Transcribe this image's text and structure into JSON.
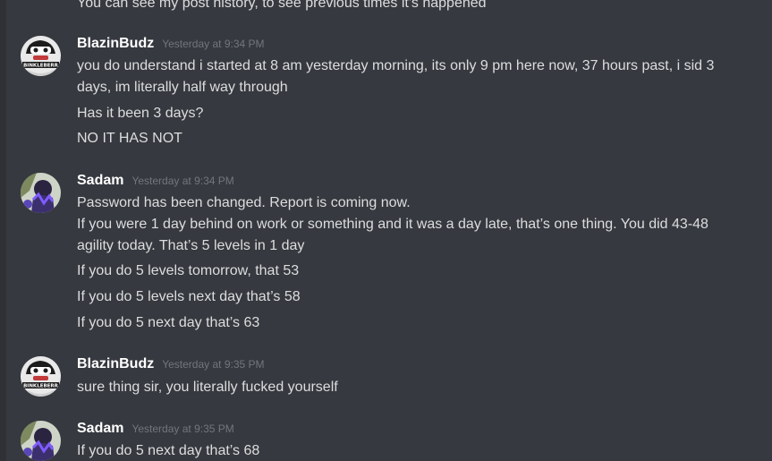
{
  "messages": {
    "top_cut": "You can see my post history, to see previous times it's happened",
    "m1": {
      "username": "BlazinBudz",
      "timestamp": "Yesterday at 9:34 PM",
      "lines": [
        "you do understand i started at 8 am yesterday morning, its only 9 pm here now, 37 hours past, i sid 3 days, im literally half way through",
        "Has it been 3 days?",
        "NO IT HAS NOT"
      ]
    },
    "m2": {
      "username": "Sadam",
      "timestamp": "Yesterday at 9:34 PM",
      "lines": [
        "Password has been changed. Report is coming now.",
        "If you were 1 day behind on work or something and it was a day late, that’s one thing. You did 43-48 agility today. That’s 5 levels in 1 day",
        "If you do 5 levels tomorrow, that 53",
        "If you do 5 levels next day that’s 58",
        "If you do 5 next day that’s 63"
      ]
    },
    "m3": {
      "username": "BlazinBudz",
      "timestamp": "Yesterday at 9:35 PM",
      "lines": [
        "sure thing sir, you literally fucked yourself"
      ]
    },
    "m4": {
      "username": "Sadam",
      "timestamp": "Yesterday at 9:35 PM",
      "lines": [
        "If you do 5 next day that’s 68"
      ]
    }
  },
  "avatar_text": "BINKLEBERR"
}
